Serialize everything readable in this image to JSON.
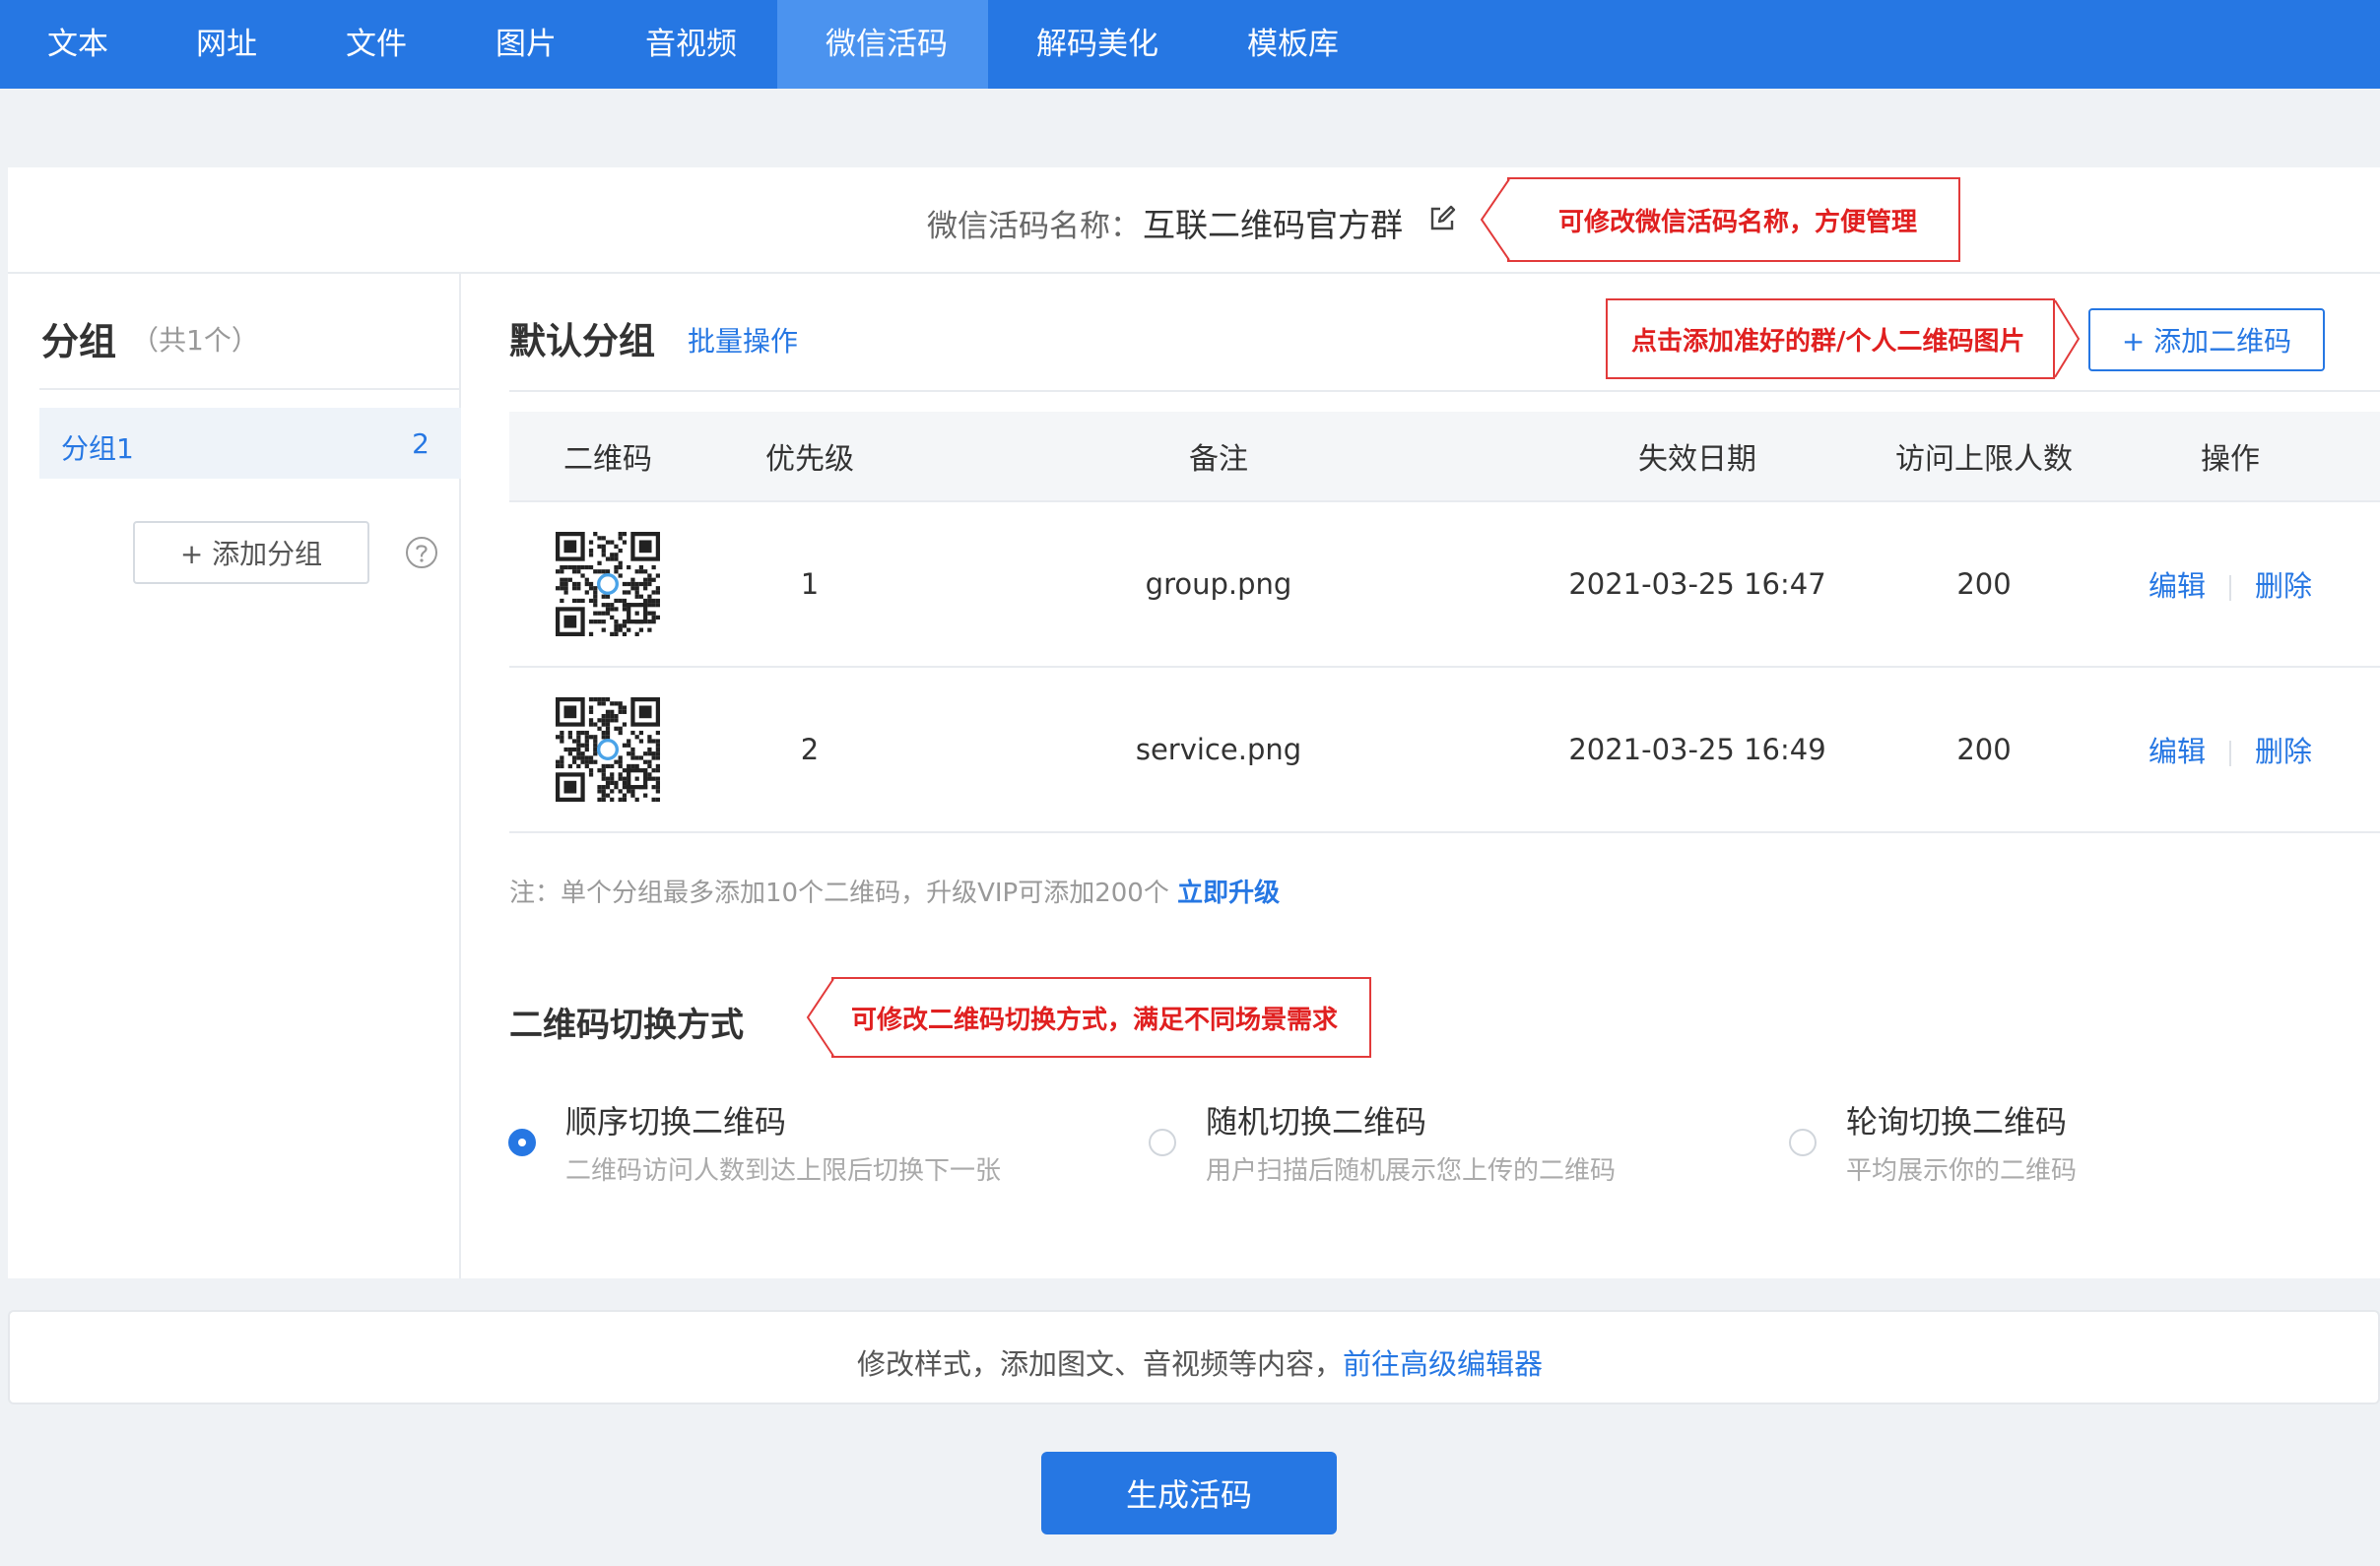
{
  "nav": {
    "items": [
      {
        "label": "文本",
        "active": false
      },
      {
        "label": "网址",
        "active": false
      },
      {
        "label": "文件",
        "active": false
      },
      {
        "label": "图片",
        "active": false
      },
      {
        "label": "音视频",
        "active": false
      },
      {
        "label": "微信活码",
        "active": true
      },
      {
        "label": "解码美化",
        "active": false
      },
      {
        "label": "模板库",
        "active": false
      }
    ]
  },
  "code_name": {
    "label": "微信活码名称：",
    "value": "互联二维码官方群"
  },
  "callouts": {
    "name_tip": "可修改微信活码名称，方便管理",
    "add_tip": "点击添加准好的群/个人二维码图片",
    "switch_tip": "可修改二维码切换方式，满足不同场景需求"
  },
  "sidebar": {
    "title": "分组",
    "count": "（共1个）",
    "groups": [
      {
        "name": "分组1",
        "count": "2"
      }
    ],
    "add_group_label": "+ 添加分组"
  },
  "content": {
    "title": "默认分组",
    "batch_label": "批量操作",
    "add_qr_label": "+ 添加二维码"
  },
  "table": {
    "headers": [
      "二维码",
      "优先级",
      "备注",
      "失效日期",
      "访问上限人数",
      "操作"
    ],
    "rows": [
      {
        "priority": "1",
        "note": "group.png",
        "expire": "2021-03-25 16:47",
        "limit": "200",
        "edit": "编辑",
        "delete": "删除"
      },
      {
        "priority": "2",
        "note": "service.png",
        "expire": "2021-03-25 16:49",
        "limit": "200",
        "edit": "编辑",
        "delete": "删除"
      }
    ]
  },
  "note": {
    "text": "注：单个分组最多添加10个二维码，升级VIP可添加200个 ",
    "link": "立即升级"
  },
  "switch_mode": {
    "title": "二维码切换方式",
    "options": [
      {
        "title": "顺序切换二维码",
        "desc": "二维码访问人数到达上限后切换下一张",
        "checked": true
      },
      {
        "title": "随机切换二维码",
        "desc": "用户扫描后随机展示您上传的二维码",
        "checked": false
      },
      {
        "title": "轮询切换二维码",
        "desc": "平均展示你的二维码",
        "checked": false
      }
    ]
  },
  "bottom": {
    "text": "修改样式，添加图文、音视频等内容，",
    "link": "前往高级编辑器"
  },
  "generate_label": "生成活码",
  "colors": {
    "primary": "#2677e3",
    "nav_active": "#4b93ef",
    "callout": "#e02020"
  }
}
